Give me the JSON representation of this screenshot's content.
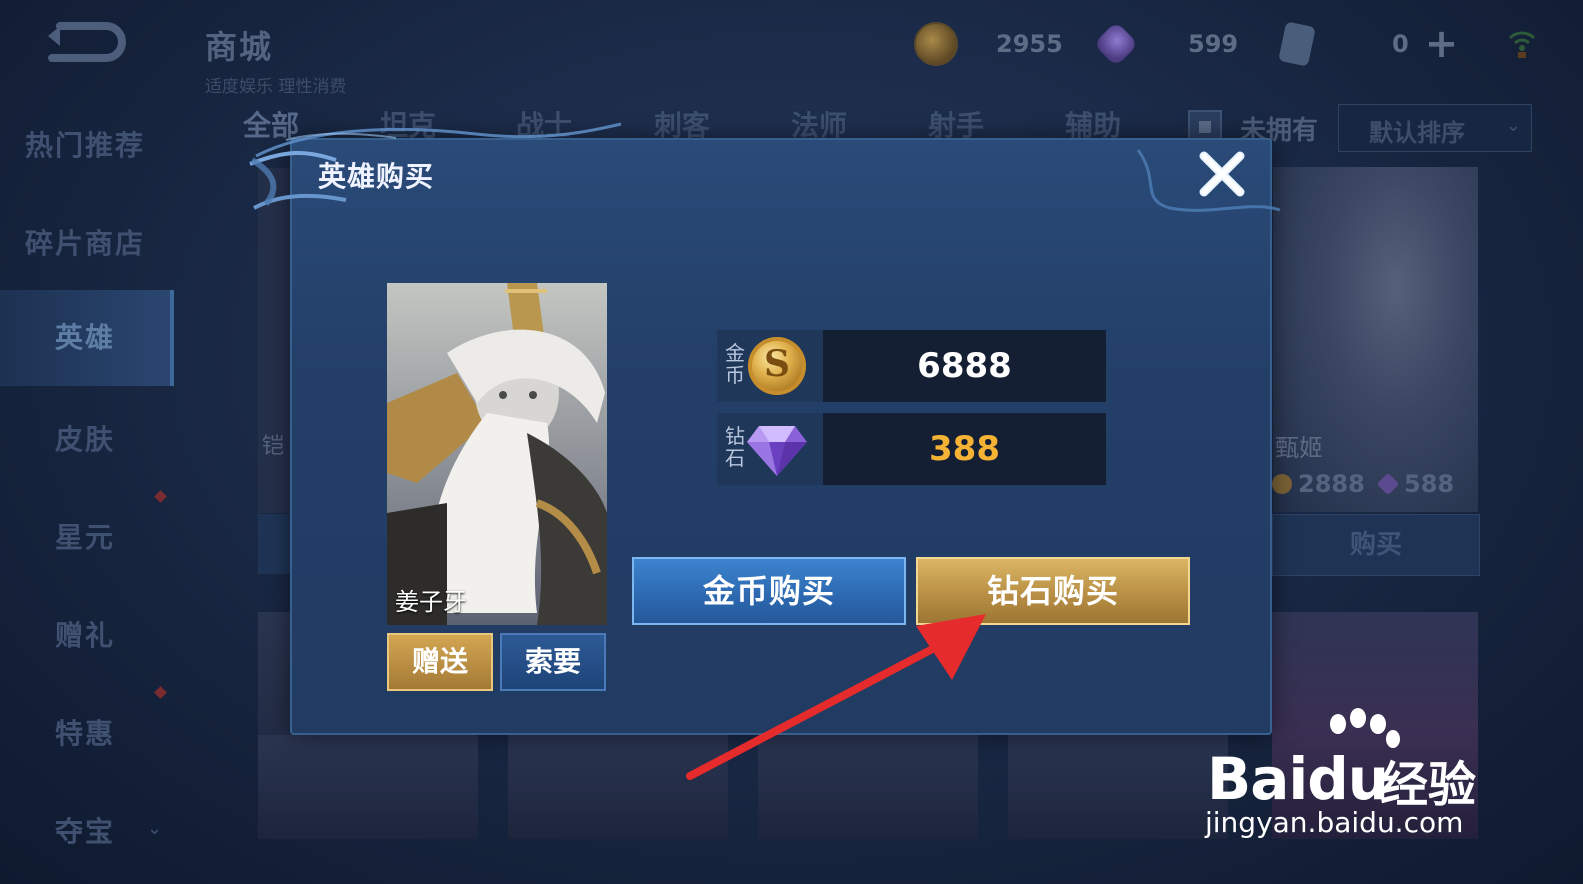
{
  "topbar": {
    "title": "商城",
    "subtitle": "适度娱乐 理性消费",
    "coins": "2955",
    "diamonds": "599",
    "coupons": "0",
    "icons": [
      "back-icon",
      "coin-icon",
      "diamond-icon",
      "coupon-icon",
      "plus-icon",
      "wifi-icon"
    ]
  },
  "sidebar": {
    "items": [
      {
        "label": "热门推荐"
      },
      {
        "label": "碎片商店"
      },
      {
        "label": "英雄"
      },
      {
        "label": "皮肤"
      },
      {
        "label": "星元"
      },
      {
        "label": "赠礼"
      },
      {
        "label": "特惠"
      },
      {
        "label": "夺宝"
      }
    ],
    "active_index": 2
  },
  "filters": {
    "tabs": [
      "全部",
      "坦克",
      "战士",
      "刺客",
      "法师",
      "射手",
      "辅助"
    ],
    "active_tab": "全部",
    "owned_label": "未拥有",
    "sort_value": "默认排序"
  },
  "background_cards": {
    "right_hero_name": "甄姬",
    "right_hero_coin_price": "2888",
    "right_hero_diamond_price": "588",
    "right_buy_label": "购买",
    "left_hero_name_fragment": "铠"
  },
  "dialog": {
    "title": "英雄购买",
    "hero_name": "姜子牙",
    "gift_label": "赠送",
    "request_label": "索要",
    "coin_label": "金币",
    "coin_price": "6888",
    "diamond_label": "钻石",
    "diamond_price": "388",
    "coin_buy_label": "金币购买",
    "diamond_buy_label": "钻石购买",
    "coin_symbol": "S"
  },
  "colors": {
    "coin_price_text": "#ffffff",
    "diamond_price_text": "#f5b335",
    "annotation_arrow": "#e52b2b"
  },
  "watermark": {
    "brand_latin": "Bai",
    "brand_du": "du",
    "brand_cn": "经验",
    "url": "jingyan.baidu.com"
  }
}
